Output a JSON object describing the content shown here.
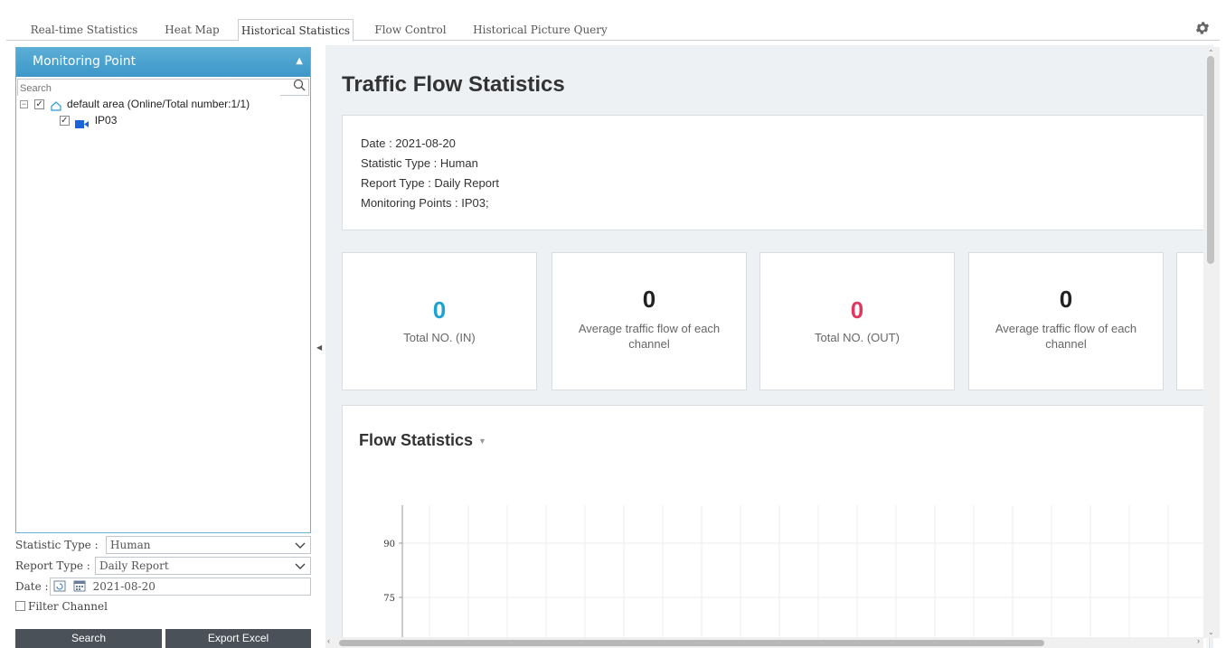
{
  "tabs": [
    {
      "label": "Real-time Statistics"
    },
    {
      "label": "Heat Map"
    },
    {
      "label": "Historical Statistics",
      "active": true
    },
    {
      "label": "Flow Control"
    },
    {
      "label": "Historical Picture Query"
    }
  ],
  "settings_icon": "gear-icon",
  "sidebar": {
    "header": "Monitoring Point",
    "search_placeholder": "Search",
    "tree": {
      "area": "default area (Online/Total number:1/1)",
      "channel": "IP03"
    }
  },
  "filters": {
    "statistic_type_label": "Statistic Type :",
    "statistic_type_value": "Human",
    "report_type_label": "Report Type :",
    "report_type_value": "Daily Report",
    "date_label": "Date :",
    "date_value": "2021-08-20",
    "filter_channel_label": "Filter Channel",
    "search_button": "Search",
    "export_button": "Export Excel"
  },
  "main": {
    "title": "Traffic Flow Statistics",
    "info": {
      "date": "Date : 2021-08-20",
      "statistic_type": "Statistic Type : Human",
      "report_type": "Report Type : Daily Report",
      "monitoring_points": "Monitoring Points : IP03;"
    },
    "cards": [
      {
        "value": "0",
        "label": "Total NO. (IN)",
        "color": "#1ea3d0"
      },
      {
        "value": "0",
        "label": "Average traffic flow of each channel",
        "color": "#222222"
      },
      {
        "value": "0",
        "label": "Total NO. (OUT)",
        "color": "#e0365f"
      },
      {
        "value": "0",
        "label": "Average traffic flow of each channel",
        "color": "#222222"
      }
    ],
    "flow_title": "Flow Statistics"
  },
  "chart_data": {
    "type": "line",
    "title": "Flow Statistics",
    "yticks": [
      90,
      75
    ],
    "grid": true,
    "series": []
  },
  "colors": {
    "accent": "#3d97c8",
    "in": "#1ea3d0",
    "out": "#e0365f"
  }
}
